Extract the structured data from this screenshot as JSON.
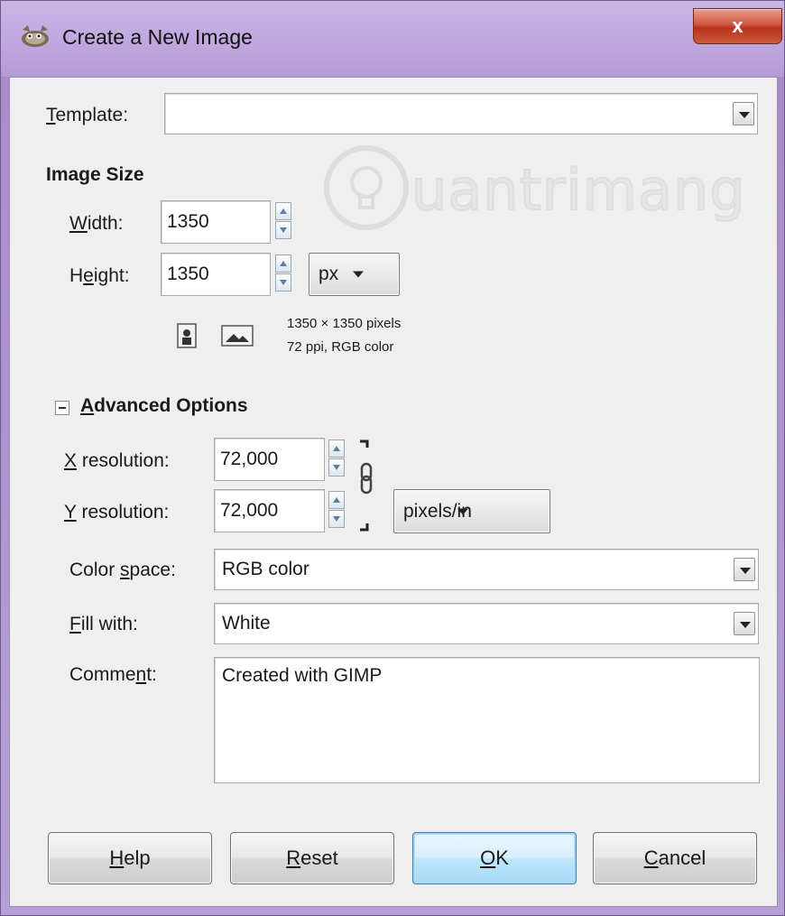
{
  "window": {
    "title": "Create a New Image",
    "close_label": "x"
  },
  "template": {
    "label_u": "T",
    "label_rest": "emplate:",
    "value": ""
  },
  "image_size": {
    "heading": "Image Size",
    "width_label_u": "W",
    "width_label_rest": "idth:",
    "width_value": "1350",
    "height_label_pre": "H",
    "height_label_u": "e",
    "height_label_rest": "ight:",
    "height_value": "1350",
    "unit": "px",
    "info_line1": "1350 × 1350 pixels",
    "info_line2": "72 ppi, RGB color"
  },
  "advanced": {
    "heading_u": "A",
    "heading_rest": "dvanced Options",
    "x_res_label_u": "X",
    "x_res_label_rest": " resolution:",
    "x_res_value": "72,000",
    "y_res_label_u": "Y",
    "y_res_label_rest": " resolution:",
    "y_res_value": "72,000",
    "res_unit": "pixels/in",
    "color_space_label_pre": "Color ",
    "color_space_label_u": "s",
    "color_space_label_rest": "pace:",
    "color_space_value": "RGB color",
    "fill_label_u": "F",
    "fill_label_rest": "ill with:",
    "fill_value": "White",
    "comment_label_pre": "Comme",
    "comment_label_u": "n",
    "comment_label_rest": "t:",
    "comment_value": "Created with GIMP"
  },
  "buttons": {
    "help_u": "H",
    "help_rest": "elp",
    "reset_u": "R",
    "reset_rest": "eset",
    "ok_u": "O",
    "ok_rest": "K",
    "cancel_u": "C",
    "cancel_rest": "ancel"
  },
  "watermark": {
    "text": "uantrimang"
  },
  "icons": {
    "app": "gimp-wilber-icon",
    "portrait": "portrait-icon",
    "landscape": "landscape-icon",
    "chain": "chain-link-icon",
    "expander": "collapse-icon"
  }
}
